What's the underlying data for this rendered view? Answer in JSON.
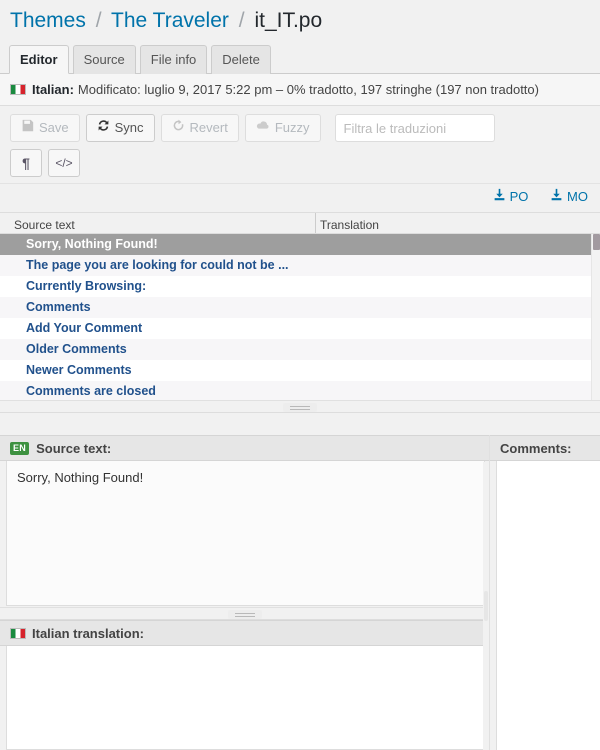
{
  "breadcrumb": {
    "items": [
      {
        "label": "Themes",
        "link": true
      },
      {
        "label": "The Traveler",
        "link": true
      },
      {
        "label": "it_IT.po",
        "link": false
      }
    ],
    "separator": "/"
  },
  "tabs": [
    {
      "label": "Editor",
      "active": true
    },
    {
      "label": "Source",
      "active": false
    },
    {
      "label": "File info",
      "active": false
    },
    {
      "label": "Delete",
      "active": false
    }
  ],
  "status": {
    "flag_icon": "italy-flag-icon",
    "language_label": "Italian:",
    "text": "Modificato: luglio 9, 2017 5:22 pm – 0% tradotto, 197 stringhe (197 non tradotto)",
    "percent_translated": "0%",
    "total_strings": "197",
    "untranslated": "197"
  },
  "toolbar": {
    "buttons": [
      {
        "label": "Save",
        "icon": "save-disk-icon",
        "disabled": true
      },
      {
        "label": "Sync",
        "icon": "sync-refresh-icon",
        "disabled": false
      },
      {
        "label": "Revert",
        "icon": "revert-undo-icon",
        "disabled": true
      },
      {
        "label": "Fuzzy",
        "icon": "cloud-fuzzy-icon",
        "disabled": true
      }
    ],
    "filter": {
      "value": "",
      "placeholder": "Filtra le traduzioni"
    },
    "format_buttons": [
      {
        "icon": "pilcrow-icon",
        "glyph": "¶",
        "title": "Invisibles"
      },
      {
        "icon": "code-tags-icon",
        "glyph": "</>",
        "title": "Code view"
      }
    ]
  },
  "downloads": [
    {
      "label": "PO",
      "icon": "download-icon"
    },
    {
      "label": "MO",
      "icon": "download-icon"
    }
  ],
  "table": {
    "columns": [
      "Source text",
      "Translation"
    ],
    "rows": [
      {
        "source": "Sorry, Nothing Found!",
        "translation": "",
        "selected": true
      },
      {
        "source": "The page you are looking for could not be ...",
        "translation": "",
        "selected": false
      },
      {
        "source": "Currently Browsing:",
        "translation": "",
        "selected": false
      },
      {
        "source": "Comments",
        "translation": "",
        "selected": false
      },
      {
        "source": "Add Your Comment",
        "translation": "",
        "selected": false
      },
      {
        "source": "Older Comments",
        "translation": "",
        "selected": false
      },
      {
        "source": "Newer Comments",
        "translation": "",
        "selected": false
      },
      {
        "source": "Comments are closed",
        "translation": "",
        "selected": false
      }
    ]
  },
  "editor": {
    "source_panel": {
      "badge": "EN",
      "title": "Source text:",
      "content": "Sorry, Nothing Found!"
    },
    "translation_panel": {
      "flag_icon": "italy-flag-icon",
      "title": "Italian translation:",
      "content": ""
    },
    "comments_panel": {
      "title": "Comments:",
      "content": ""
    }
  },
  "colors": {
    "link": "#0073aa",
    "row_text": "#21518c",
    "selected_row_bg": "#9e9e9e",
    "badge_green": "#3d9140",
    "flag_green": "#1a8a3f",
    "flag_red": "#d6232c"
  }
}
